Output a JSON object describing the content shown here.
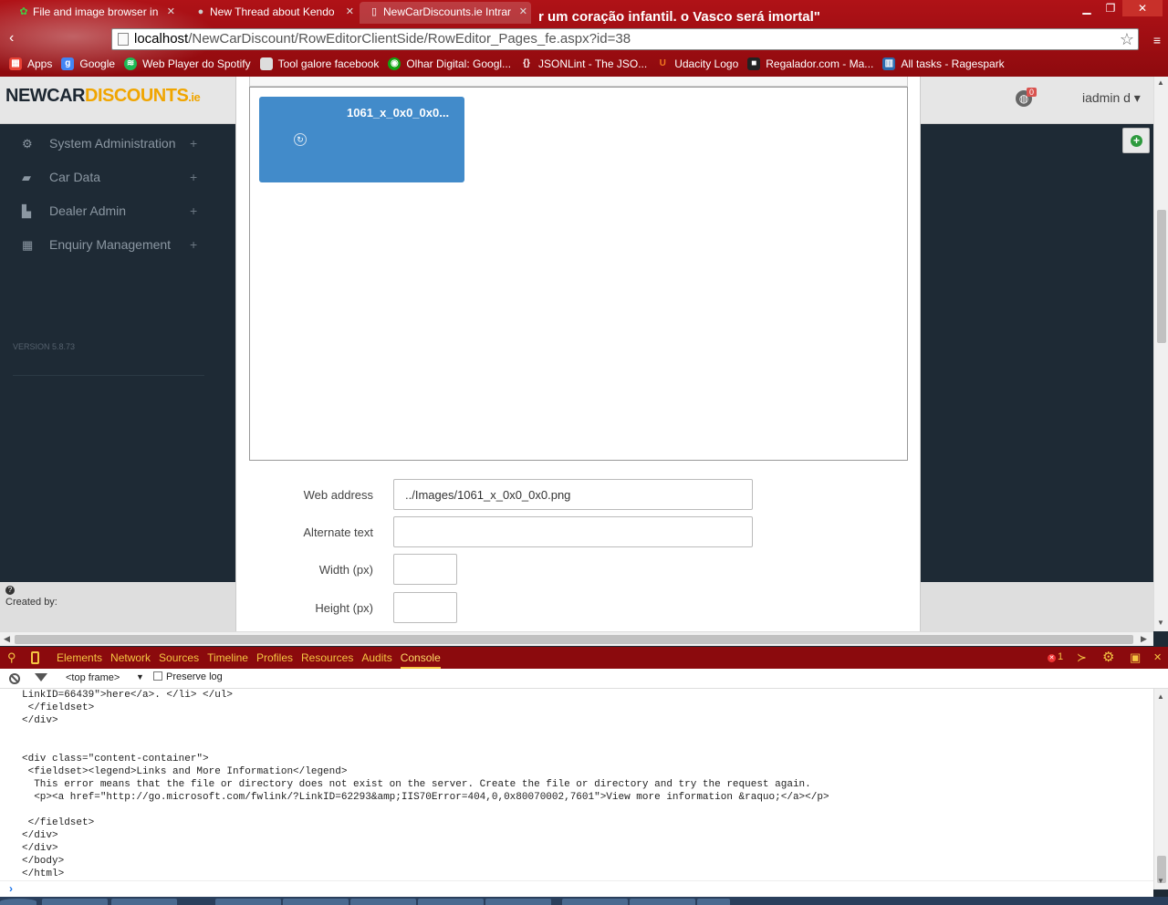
{
  "browser": {
    "tabs": [
      {
        "title": "File and image browser in",
        "icon": "green-gear-icon"
      },
      {
        "title": "New Thread about Kendo",
        "icon": "forum-icon"
      },
      {
        "title": "NewCarDiscounts.ie Intrar",
        "icon": "page-icon"
      }
    ],
    "theme_banner": "r um coração infantil. o Vasco será imortal\"",
    "url_host": "localhost",
    "url_path": "/NewCarDiscount/RowEditorClientSide/RowEditor_Pages_fe.aspx?id=38",
    "bookmarks": [
      {
        "label": "Apps",
        "color": "#e94235"
      },
      {
        "label": "Google",
        "color": "#4285f4"
      },
      {
        "label": "Web Player do Spotify",
        "color": "#1db954"
      },
      {
        "label": "Tool galore facebook",
        "color": "#dddddd"
      },
      {
        "label": "Olhar Digital: Googl...",
        "color": "#12a312"
      },
      {
        "label": "JSONLint - The JSO...",
        "color": "#666666"
      },
      {
        "label": "Udacity Logo",
        "color": "#f47a20"
      },
      {
        "label": "Regalador.com - Ma...",
        "color": "#222222"
      },
      {
        "label": "All tasks - Ragespark",
        "color": "#2b6cb0"
      }
    ]
  },
  "app": {
    "logo": {
      "part1": "NEWCAR",
      "part2": "DISCOUNTS",
      "part3": ".ie"
    },
    "notification_count": "0",
    "user": "iadmin d ▾",
    "sidebar": [
      {
        "label": "System Administration",
        "icon": "gear-icon"
      },
      {
        "label": "Car Data",
        "icon": "car-icon"
      },
      {
        "label": "Dealer Admin",
        "icon": "building-icon"
      },
      {
        "label": "Enquiry Management",
        "icon": "calendar-icon"
      }
    ],
    "version": "VERSION 5.8.73",
    "footer_created": "Created by:"
  },
  "modal": {
    "file_tile_name": "1061_x_0x0_0x0...",
    "fields": {
      "web_address_label": "Web address",
      "web_address_value": "../Images/1061_x_0x0_0x0.png",
      "alt_text_label": "Alternate text",
      "alt_text_value": "",
      "width_label": "Width (px)",
      "width_value": "",
      "height_label": "Height (px)",
      "height_value": ""
    }
  },
  "devtools": {
    "tabs": [
      "Elements",
      "Network",
      "Sources",
      "Timeline",
      "Profiles",
      "Resources",
      "Audits",
      "Console"
    ],
    "active_tab": "Console",
    "error_count": "1",
    "frame": "<top frame>",
    "preserve_log": "Preserve log",
    "console_lines": [
      "LinkID=66439\">here</a>. </li> </ul>",
      " </fieldset>",
      "</div>",
      "",
      "",
      "<div class=\"content-container\">",
      " <fieldset><legend>Links and More Information</legend>",
      "  This error means that the file or directory does not exist on the server. Create the file or directory and try the request again.",
      "  <p><a href=\"http://go.microsoft.com/fwlink/?LinkID=62293&amp;IIS70Error=404,0,0x80070002,7601\">View more information &raquo;</a></p>",
      "",
      " </fieldset>",
      "</div>",
      "</div>",
      "</body>",
      "</html>"
    ]
  }
}
